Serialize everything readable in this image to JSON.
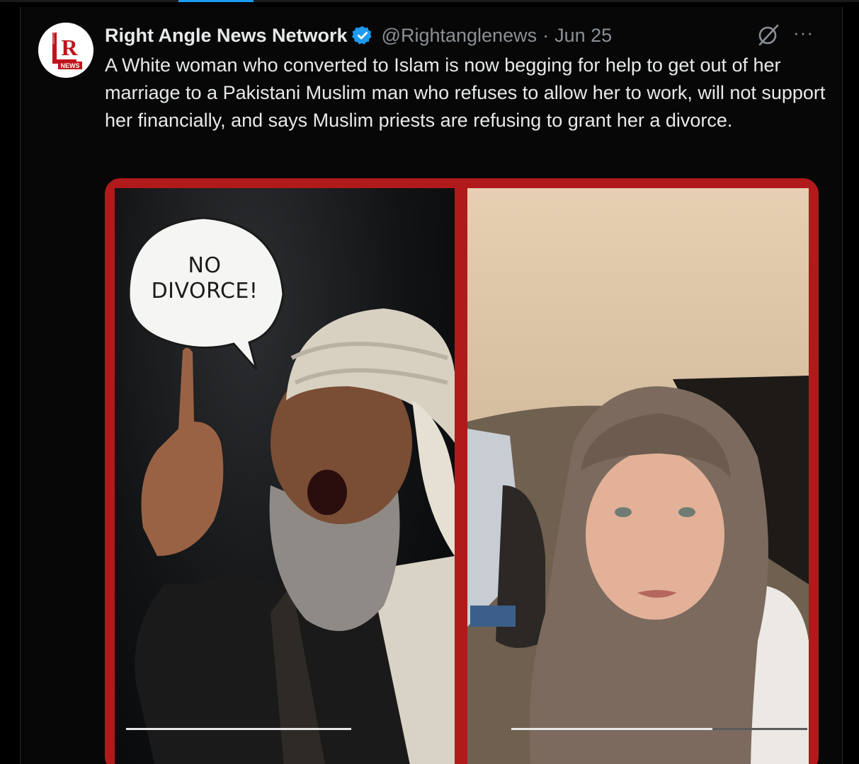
{
  "nav": {
    "active_tab_color": "#1d9bf0"
  },
  "post": {
    "author_name": "Right Angle News Network",
    "handle": "@Rightanglenews",
    "separator": "·",
    "date": "Jun 25",
    "verified_icon": "verified-badge-icon",
    "more_label": "···",
    "text": "A White woman who converted to Islam is now begging for help to get out of her marriage to a Pakistani Muslim man who refuses to allow her to work, will not support her financially, and says Muslim priests are refusing to grant her a divorce."
  },
  "avatar": {
    "logo_letter": "R",
    "logo_word": "NEWS",
    "logo_small": "RIGHT ANGLE"
  },
  "media": {
    "left_panel": {
      "speech_bubble": "NO\nDIVORCE!",
      "progress": 1.0
    },
    "right_panel": {
      "progress": 0.68
    },
    "border_color": "#b01a1a"
  }
}
